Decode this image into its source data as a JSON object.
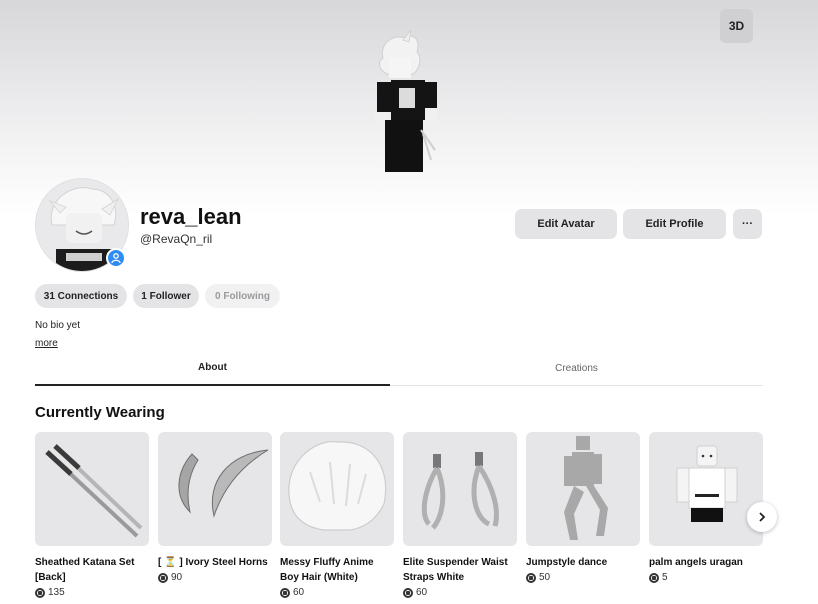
{
  "header": {
    "view_toggle_label": "3D"
  },
  "profile": {
    "display_name": "reva_lean",
    "username": "@RevaQn_ril",
    "bio": "No bio yet",
    "more_label": "more"
  },
  "actions": {
    "edit_avatar": "Edit Avatar",
    "edit_profile": "Edit Profile",
    "more": "···"
  },
  "stats": {
    "connections": "31 Connections",
    "followers": "1 Follower",
    "following": "0 Following"
  },
  "tabs": [
    {
      "label": "About",
      "active": true
    },
    {
      "label": "Creations",
      "active": false
    }
  ],
  "wearing": {
    "title": "Currently Wearing",
    "items": [
      {
        "name": "Sheathed Katana Set [Back]",
        "price": "135",
        "icon": "katana-icon"
      },
      {
        "name": "[ ⏳ ] Ivory Steel Horns",
        "price": "90",
        "icon": "horns-icon"
      },
      {
        "name": "Messy Fluffy Anime Boy Hair (White)",
        "price": "60",
        "icon": "hair-icon"
      },
      {
        "name": "Elite Suspender Waist Straps White",
        "price": "60",
        "icon": "straps-icon"
      },
      {
        "name": "Jumpstyle dance",
        "price": "50",
        "icon": "dance-icon"
      },
      {
        "name": "palm angels uragan",
        "price": "5",
        "icon": "shirt-icon"
      }
    ]
  },
  "colors": {
    "accent": "#2f8cf2",
    "button_bg": "#e4e4e6",
    "thumb_bg": "#e6e6e9"
  }
}
